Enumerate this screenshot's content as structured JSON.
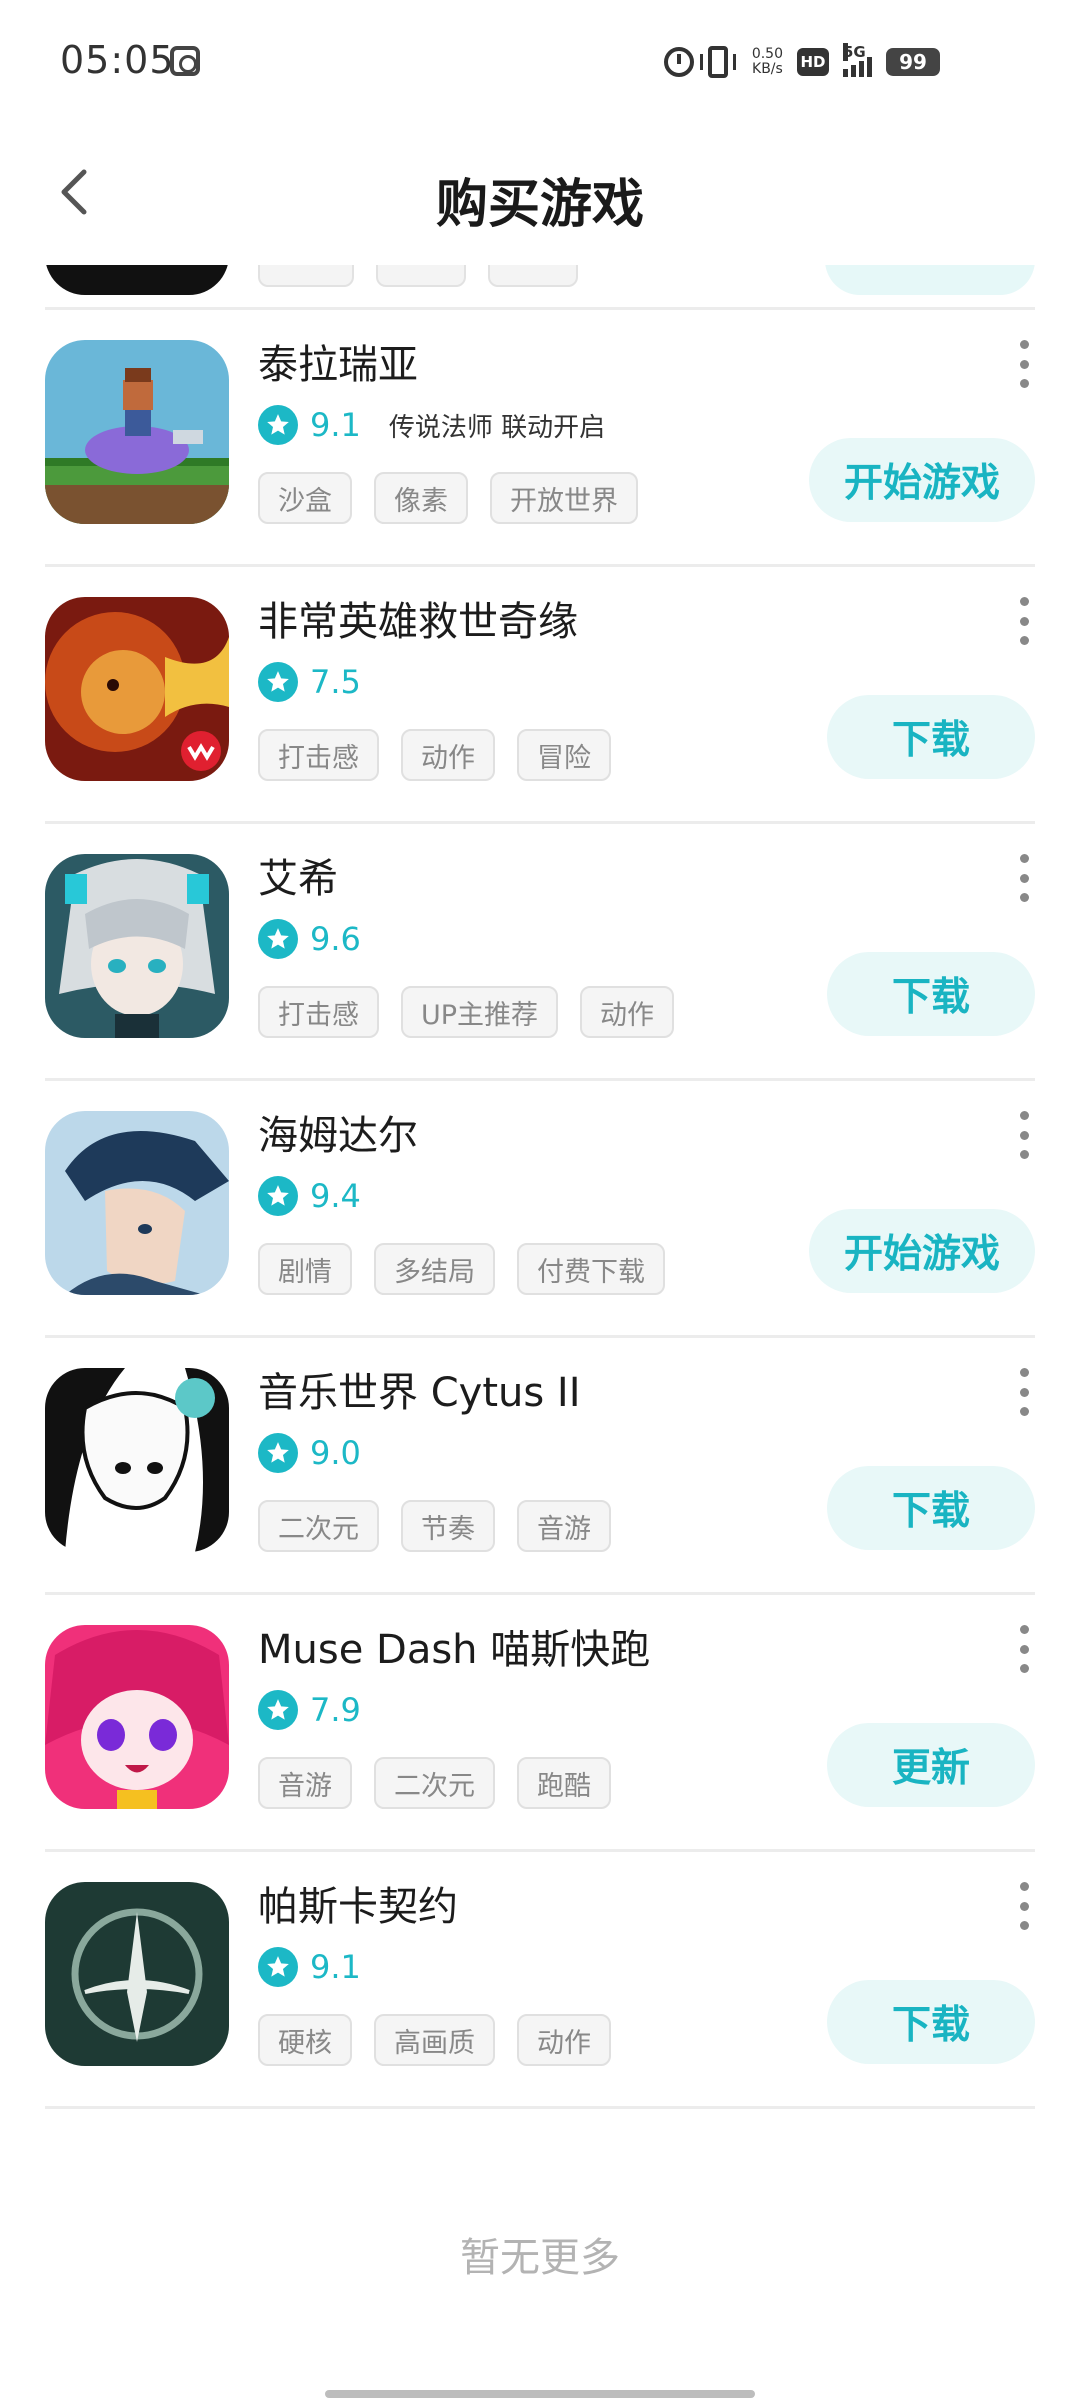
{
  "status_bar": {
    "time": "05:05",
    "net_speed_value": "0.50",
    "net_speed_unit": "KB/s",
    "hd_badge": "HD",
    "network": "5G",
    "battery": "99"
  },
  "header": {
    "title": "购买游戏"
  },
  "colors": {
    "accent": "#1cb8c6",
    "button_bg": "#e8f8f8",
    "tag_text": "#888888",
    "divider": "#ececec"
  },
  "games": [
    {
      "name": "泰拉瑞亚",
      "rating": "9.1",
      "promo": "传说法师 联动开启",
      "tags": [
        "沙盒",
        "像素",
        "开放世界"
      ],
      "action": "开始游戏",
      "icon": "terraria-icon"
    },
    {
      "name": "非常英雄救世奇缘",
      "rating": "7.5",
      "promo": "",
      "tags": [
        "打击感",
        "动作",
        "冒险"
      ],
      "action": "下载",
      "icon": "monkey-king-icon"
    },
    {
      "name": "艾希",
      "rating": "9.6",
      "promo": "",
      "tags": [
        "打击感",
        "UP主推荐",
        "动作"
      ],
      "action": "下载",
      "icon": "icey-icon"
    },
    {
      "name": "海姆达尔",
      "rating": "9.4",
      "promo": "",
      "tags": [
        "剧情",
        "多结局",
        "付费下载"
      ],
      "action": "开始游戏",
      "icon": "heimdall-icon"
    },
    {
      "name": "音乐世界 Cytus II",
      "rating": "9.0",
      "promo": "",
      "tags": [
        "二次元",
        "节奏",
        "音游"
      ],
      "action": "下载",
      "icon": "cytus-icon"
    },
    {
      "name": "Muse Dash 喵斯快跑",
      "rating": "7.9",
      "promo": "",
      "tags": [
        "音游",
        "二次元",
        "跑酷"
      ],
      "action": "更新",
      "icon": "muse-dash-icon"
    },
    {
      "name": "帕斯卡契约",
      "rating": "9.1",
      "promo": "",
      "tags": [
        "硬核",
        "高画质",
        "动作"
      ],
      "action": "下载",
      "icon": "pascal-icon"
    }
  ],
  "footer": {
    "no_more": "暂无更多"
  }
}
